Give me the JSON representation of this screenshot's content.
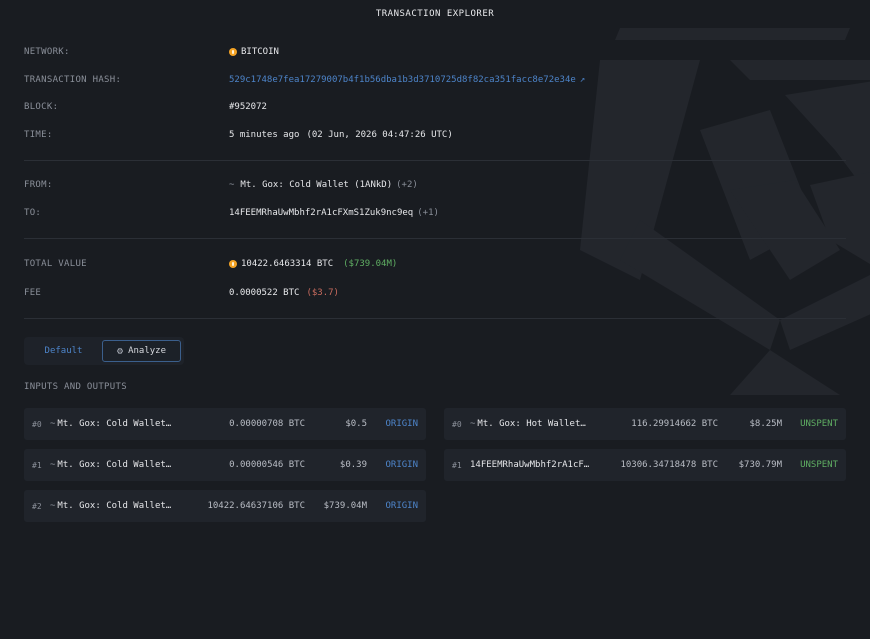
{
  "header": {
    "title": "TRANSACTION EXPLORER"
  },
  "details": {
    "network": {
      "label": "NETWORK:",
      "value": "BITCOIN"
    },
    "hash": {
      "label": "TRANSACTION HASH:",
      "value": "529c1748e7fea17279007b4f1b56dba1b3d3710725d8f82ca351facc8e72e34e"
    },
    "block": {
      "label": "BLOCK:",
      "value": "#952072"
    },
    "time": {
      "label": "TIME:",
      "relative": "5 minutes ago",
      "absolute": "(02 Jun, 2026 04:47:26 UTC)"
    },
    "from": {
      "label": "FROM:",
      "value": "Mt. Gox: Cold Wallet (1ANkD)",
      "extra": "(+2)"
    },
    "to": {
      "label": "TO:",
      "value": "14FEEMRhaUwMbhf2rA1cFXmS1Zuk9nc9eq",
      "extra": "(+1)"
    },
    "total_value": {
      "label": "TOTAL VALUE",
      "btc": "10422.6463314 BTC",
      "usd": "($739.04M)"
    },
    "fee": {
      "label": "FEE",
      "btc": "0.0000522 BTC",
      "usd": "($3.7)"
    }
  },
  "tabs": {
    "default_label": "Default",
    "analyze_label": "Analyze"
  },
  "io": {
    "title": "INPUTS AND OUTPUTS",
    "inputs": [
      {
        "idx": "#0",
        "name": "Mt. Gox: Cold Wallet…",
        "amount": "0.00000708 BTC",
        "usd": "$0.5",
        "tag": "ORIGIN"
      },
      {
        "idx": "#1",
        "name": "Mt. Gox: Cold Wallet…",
        "amount": "0.00000546 BTC",
        "usd": "$0.39",
        "tag": "ORIGIN"
      },
      {
        "idx": "#2",
        "name": "Mt. Gox: Cold Wallet…",
        "amount": "10422.64637106 BTC",
        "usd": "$739.04M",
        "tag": "ORIGIN"
      }
    ],
    "outputs": [
      {
        "idx": "#0",
        "name": "Mt. Gox: Hot Wallet…",
        "amount": "116.29914662 BTC",
        "usd": "$8.25M",
        "tag": "UNSPENT"
      },
      {
        "idx": "#1",
        "name": "14FEEMRhaUwMbhf2rA1cF…",
        "amount": "10306.34718478 BTC",
        "usd": "$730.79M",
        "tag": "UNSPENT"
      }
    ]
  },
  "colors": {
    "accent": "#4d84c9",
    "positive": "#5fae63",
    "negative": "#c86b5e",
    "btc": "#f4a325"
  }
}
